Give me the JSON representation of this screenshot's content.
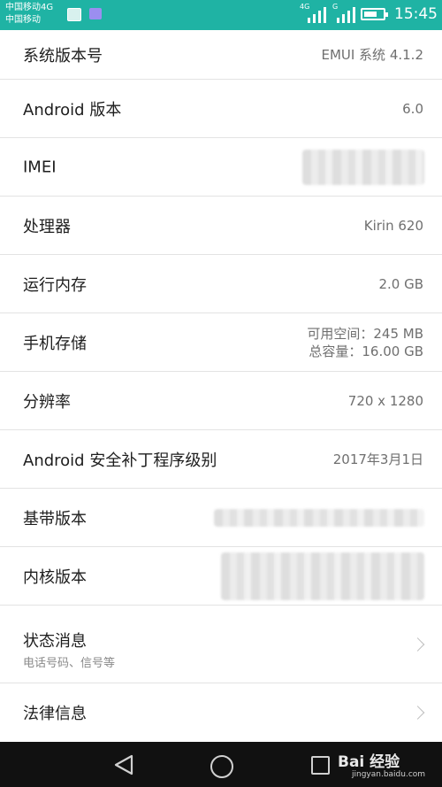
{
  "status_bar": {
    "carrier_1": "中国移动4G",
    "carrier_2": "中国移动",
    "net_1": "4G",
    "net_2": "G",
    "time": "15:45"
  },
  "rows": [
    {
      "label": "系统版本号",
      "value": "EMUI 系统 4.1.2"
    },
    {
      "label": "Android 版本",
      "value": "6.0"
    },
    {
      "label": "IMEI",
      "value_redacted": true
    },
    {
      "label": "处理器",
      "value": "Kirin 620"
    },
    {
      "label": "运行内存",
      "value": "2.0 GB"
    },
    {
      "label": "手机存储",
      "value_line1": "可用空间：245 MB",
      "value_line2": "总容量：16.00 GB"
    },
    {
      "label": "分辨率",
      "value": "720 x 1280"
    },
    {
      "label": "Android 安全补丁程序级别",
      "value": "2017年3月1日"
    },
    {
      "label": "基带版本",
      "value_redacted": true
    },
    {
      "label": "内核版本",
      "value_redacted": true
    },
    {
      "label": "状态消息",
      "subtitle": "电话号码、信号等",
      "icon": "chevron-right-icon"
    },
    {
      "label": "法律信息",
      "icon": "chevron-right-icon"
    }
  ],
  "nav_bar": {
    "icons": [
      "back-icon",
      "home-icon",
      "recent-apps-icon"
    ]
  },
  "watermark": {
    "brand": "Bai 经验",
    "url": "jingyan.baidu.com"
  }
}
